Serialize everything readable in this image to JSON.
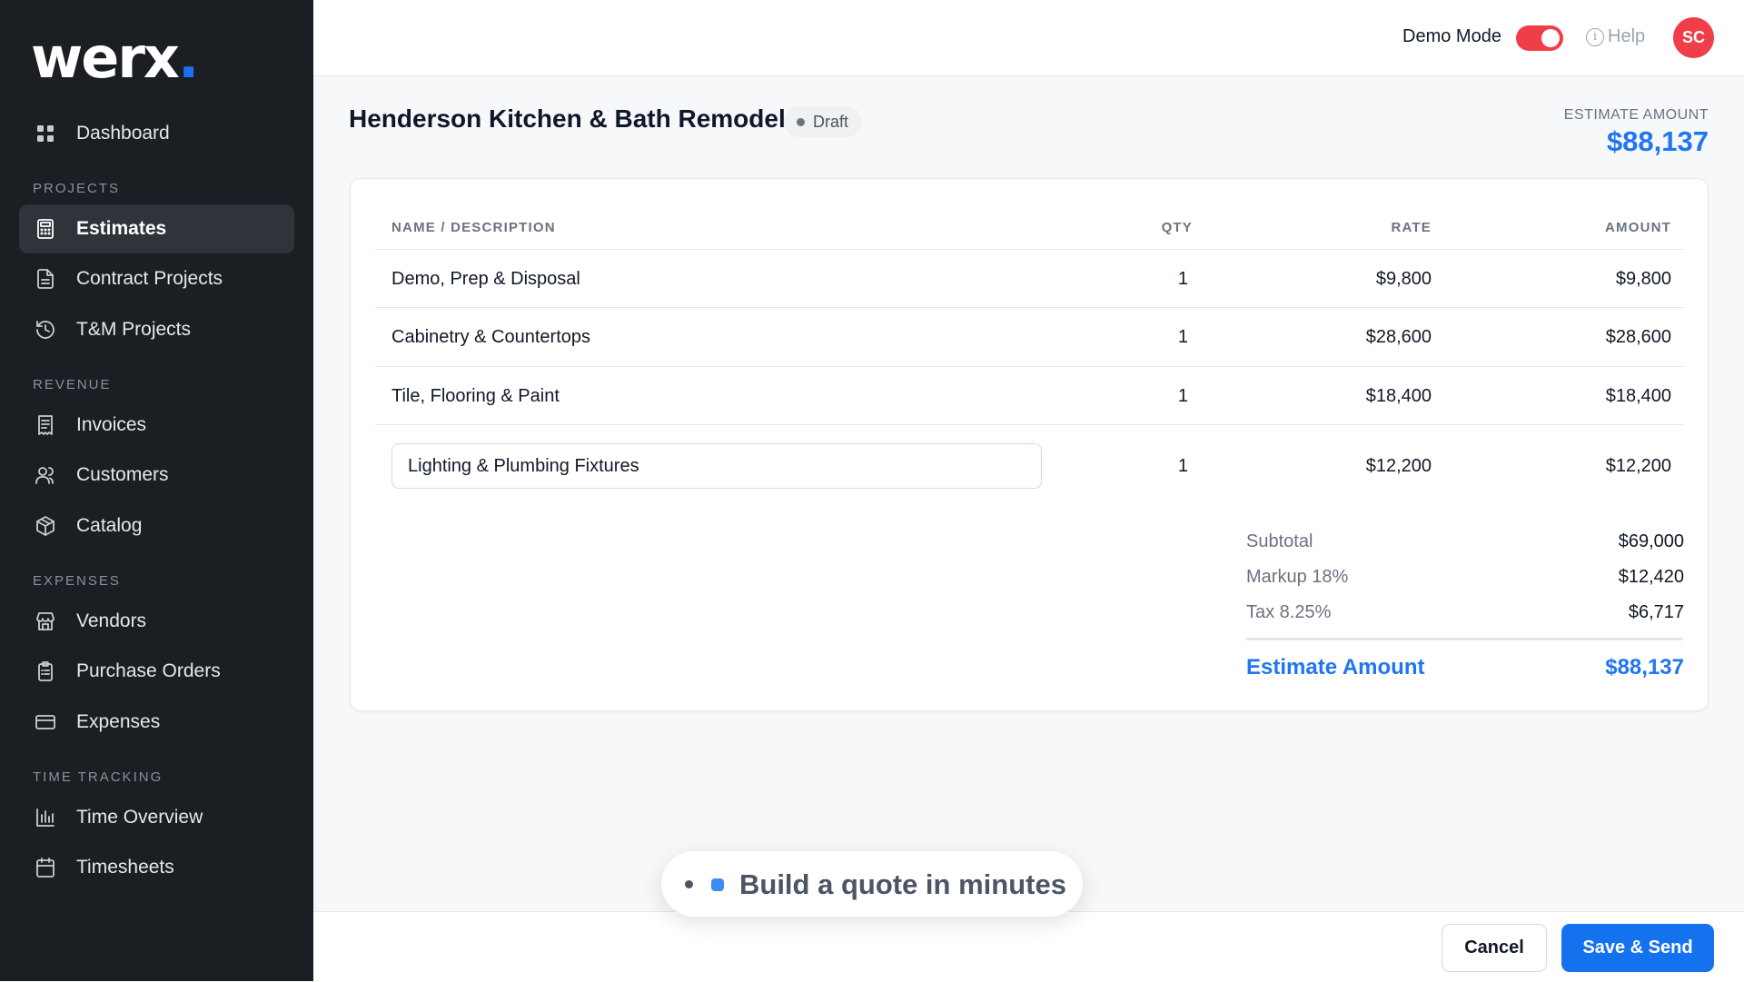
{
  "app": {
    "logo": "werx",
    "logo_dot": "."
  },
  "sidebar": {
    "dashboard": {
      "label": "Dashboard",
      "icon": "grid-icon"
    },
    "sections": [
      {
        "label": "PROJECTS"
      },
      {
        "label": "REVENUE"
      },
      {
        "label": "EXPENSES"
      },
      {
        "label": "TIME TRACKING"
      }
    ],
    "items": [
      {
        "label": "Estimates",
        "icon": "calculator-icon",
        "active": true
      },
      {
        "label": "Contract Projects",
        "icon": "document-icon"
      },
      {
        "label": "T&M Projects",
        "icon": "history-icon"
      },
      {
        "label": "Invoices",
        "icon": "receipt-icon"
      },
      {
        "label": "Customers",
        "icon": "users-icon"
      },
      {
        "label": "Catalog",
        "icon": "box-icon"
      },
      {
        "label": "Vendors",
        "icon": "store-icon"
      },
      {
        "label": "Purchase Orders",
        "icon": "clipboard-icon"
      },
      {
        "label": "Expenses",
        "icon": "credit-card-icon"
      },
      {
        "label": "Time Overview",
        "icon": "bar-chart-icon"
      },
      {
        "label": "Timesheets",
        "icon": "calendar-icon"
      }
    ]
  },
  "topbar": {
    "demo_mode_label": "Demo Mode",
    "demo_mode_on": true,
    "help_label": "Help",
    "avatar_initials": "SC"
  },
  "header": {
    "title": "Henderson Kitchen & Bath Remodel",
    "status": "Draft",
    "estimate_label": "ESTIMATE AMOUNT",
    "estimate_value": "$88,137"
  },
  "table": {
    "columns": [
      "NAME / DESCRIPTION",
      "QTY",
      "RATE",
      "AMOUNT"
    ],
    "rows": [
      {
        "name": "Demo, Prep & Disposal",
        "qty": "1",
        "rate": "$9,800",
        "amount": "$9,800"
      },
      {
        "name": "Cabinetry & Countertops",
        "qty": "1",
        "rate": "$28,600",
        "amount": "$28,600"
      },
      {
        "name": "Tile, Flooring & Paint",
        "qty": "1",
        "rate": "$18,400",
        "amount": "$18,400"
      },
      {
        "name": "Lighting & Plumbing Fixtures",
        "qty": "1",
        "rate": "$12,200",
        "amount": "$12,200"
      }
    ]
  },
  "summary": {
    "subtotal_label": "Subtotal",
    "subtotal_value": "$69,000",
    "markup_label": "Markup 18%",
    "markup_value": "$12,420",
    "tax_label": "Tax 8.25%",
    "tax_value": "$6,717",
    "total_label": "Estimate Amount",
    "total_value": "$88,137"
  },
  "footer": {
    "cancel_label": "Cancel",
    "save_label": "Save & Send"
  },
  "toast": {
    "message": "Build a quote in minutes"
  },
  "colors": {
    "accent": "#1572ee",
    "danger": "#ef3d4a",
    "sidebar_bg": "#1b1f24"
  }
}
